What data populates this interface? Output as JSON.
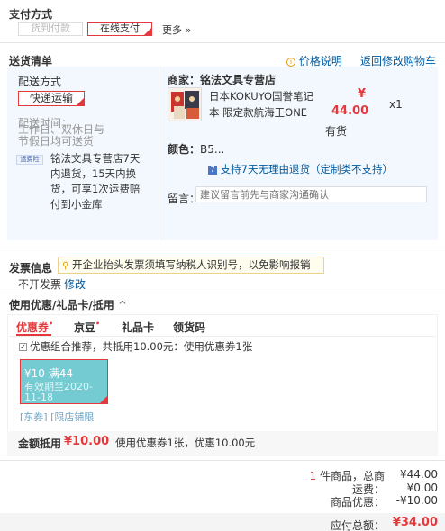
{
  "payment": {
    "title": "支付方式",
    "cod_label": "货到付款",
    "online_label": "在线支付",
    "more_label": "更多 »"
  },
  "delivery": {
    "title": "送货清单",
    "price_note": "价格说明",
    "back_link": "返回修改购物车",
    "method_title": "配送方式",
    "method_value": "快递运输",
    "time_title": "配送时间：",
    "time_value_line1": "工作日、双休日与",
    "time_value_line2": "节假日均可送货",
    "service_badge": "运费险",
    "service_text": [
      "铭法文具专营店7天",
      "内退货，15天内换",
      "货，可享1次运费赔",
      "付到小金库"
    ]
  },
  "shop": {
    "merchant_label": "商家：",
    "merchant_name": "铭法文具专营店",
    "product_title_line1": "日本KOKUYO国誉笔记",
    "product_title_line2": "本 限定款航海王ONE",
    "price_symbol": "¥",
    "price": "44.00",
    "quantity": "x1",
    "stock": "有货",
    "color_label": "颜色：",
    "color_value": "B5...",
    "return_badge": "7",
    "return_text": "支持7天无理由退货（定制类不支持）",
    "message_label": "留言：",
    "message_placeholder": "建议留言前先与商家沟通确认"
  },
  "invoice": {
    "title": "发票信息",
    "warning": "开企业抬头发票须填写纳税人识别号，以免影响报销",
    "status": "不开发票",
    "edit_link": "修改"
  },
  "coupons": {
    "title": "使用优惠/礼品卡/抵用",
    "tabs": [
      "优惠券",
      "京豆",
      "礼品卡",
      "领货码"
    ],
    "tab_dot": "•",
    "combo_text": "优惠组合推荐，共抵用10.00元：使用优惠券1张",
    "card_amount": "¥10 满44",
    "card_validity_1": "有效期至2020-",
    "card_validity_2": "11-18",
    "card_tag": "[东券] [限店铺限",
    "total_label": "金额抵用",
    "total_value": "¥10.00",
    "total_desc": "使用优惠券1张，优惠10.00元"
  },
  "summary": {
    "item_count": "1",
    "item_label": "件商品，总商",
    "goods_total": "¥44.00",
    "freight_label": "运费：",
    "freight_value": "¥0.00",
    "discount_label": "商品优惠：",
    "discount_value": "-¥10.00",
    "pay_label": "应付总额：",
    "pay_value": "¥34.00"
  },
  "colors": {
    "accent": "#e4393c",
    "link": "#005aa0",
    "panel": "#f3f8fe",
    "coupon": "#74cbd2"
  }
}
